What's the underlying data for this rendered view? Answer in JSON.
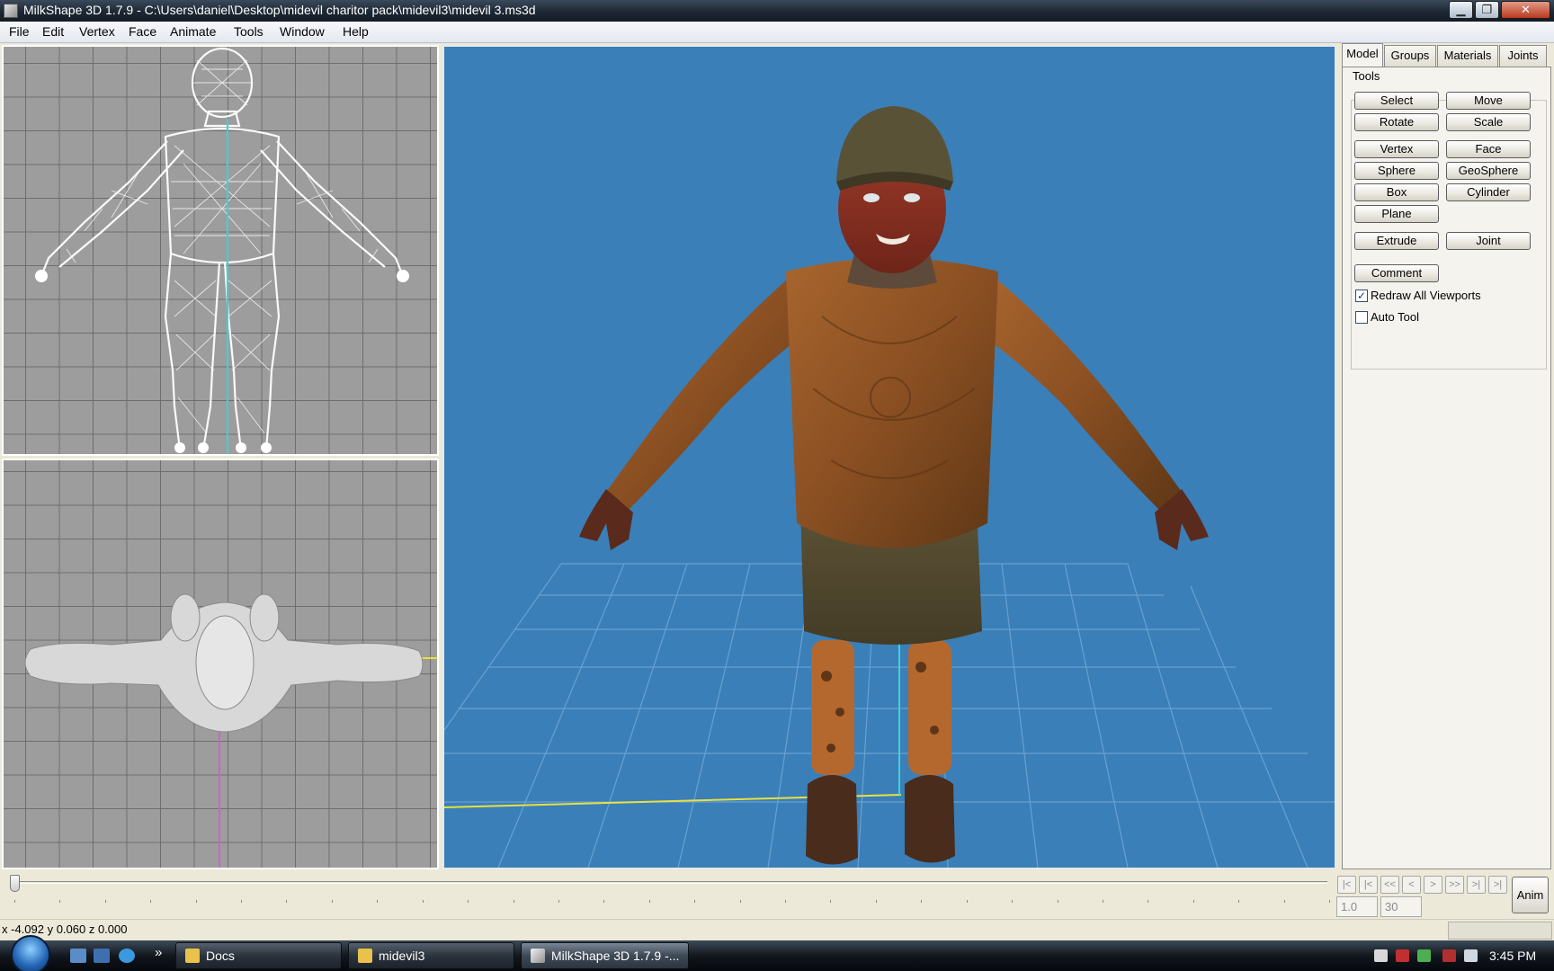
{
  "window": {
    "title": "MilkShape 3D 1.7.9 - C:\\Users\\daniel\\Desktop\\midevil charitor pack\\midevil3\\midevil 3.ms3d",
    "minimize": "▁",
    "maximize": "❐",
    "close": "✕"
  },
  "menu": [
    "File",
    "Edit",
    "Vertex",
    "Face",
    "Animate",
    "Tools",
    "Window",
    "Help"
  ],
  "panel": {
    "tabs": [
      "Model",
      "Groups",
      "Materials",
      "Joints"
    ],
    "active_tab": "Model",
    "group_label": "Tools",
    "buttons": {
      "select": "Select",
      "move": "Move",
      "rotate": "Rotate",
      "scale": "Scale",
      "vertex": "Vertex",
      "face": "Face",
      "sphere": "Sphere",
      "geosphere": "GeoSphere",
      "box": "Box",
      "cylinder": "Cylinder",
      "plane": "Plane",
      "extrude": "Extrude",
      "joint": "Joint",
      "comment": "Comment"
    },
    "redraw_all": {
      "label": "Redraw All Viewports",
      "checked": true,
      "mark": "✓"
    },
    "auto_tool": {
      "label": "Auto Tool",
      "checked": false,
      "mark": ""
    }
  },
  "timeline": {
    "nav": [
      "|<",
      "|<",
      "<<",
      "<",
      ">",
      ">>",
      ">|",
      ">|"
    ],
    "current_frame": "1.0",
    "total_frames": "30",
    "anim_label": "Anim"
  },
  "status": {
    "coords": "x -4.092 y 0.060 z 0.000"
  },
  "taskbar": {
    "quicklaunch_more": "»",
    "tasks": [
      {
        "label": "Docs",
        "active": false
      },
      {
        "label": "midevil3",
        "active": false
      },
      {
        "label": "MilkShape 3D 1.7.9 -...",
        "active": true
      }
    ],
    "clock": "3:45 PM"
  },
  "colors": {
    "viewport_3d_bg": "#3b7fb8",
    "viewport_2d_bg": "#9d9d9d",
    "wireframe": "#ffffff",
    "axis_cyan": "#3fd0d8",
    "axis_yellow": "#e8e040",
    "axis_magenta": "#d060d0"
  }
}
